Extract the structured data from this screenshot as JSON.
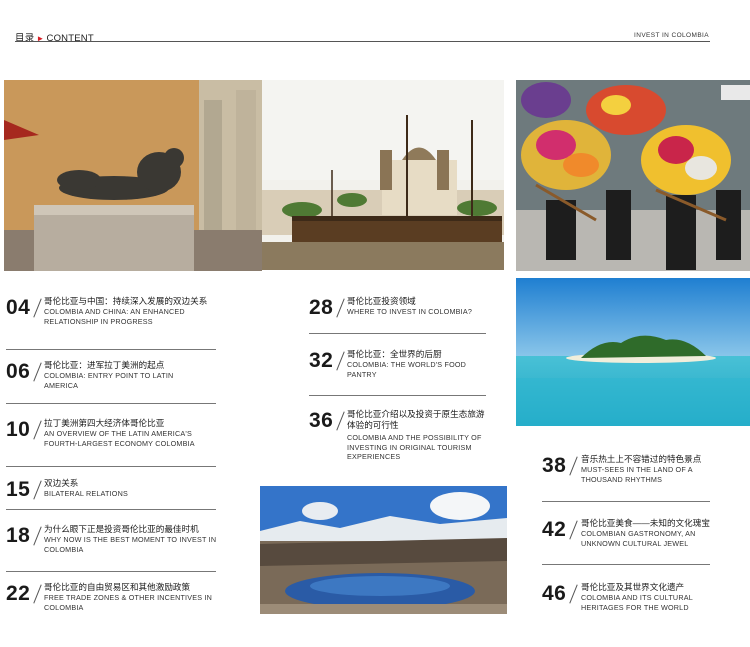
{
  "header": {
    "title_cn": "目录",
    "title_en": "CONTENT",
    "publication": "INVEST IN COLOMBIA"
  },
  "photos": {
    "sculpture": "botero-sculpture-photo",
    "cartagena": "cartagena-ship-photo",
    "flowers": "flower-festival-photo",
    "island": "tropical-island-photo",
    "lagoon": "andes-lagoon-photo"
  },
  "entries": [
    {
      "num": "04",
      "cn": "哥伦比亚与中国：持续深入发展的双边关系",
      "en": "COLOMBIA AND CHINA: AN ENHANCED RELATIONSHIP IN PROGRESS"
    },
    {
      "num": "06",
      "cn": "哥伦比亚：进军拉丁美洲的起点",
      "en": "COLOMBIA: ENTRY POINT TO LATIN AMERICA"
    },
    {
      "num": "10",
      "cn": "拉丁美洲第四大经济体哥伦比亚",
      "en": "AN OVERVIEW OF THE LATIN AMERICA'S FOURTH-LARGEST ECONOMY COLOMBIA"
    },
    {
      "num": "15",
      "cn": "双边关系",
      "en": "BILATERAL RELATIONS"
    },
    {
      "num": "18",
      "cn": "为什么眼下正是投资哥伦比亚的最佳时机",
      "en": "WHY NOW IS THE BEST MOMENT TO INVEST IN COLOMBIA"
    },
    {
      "num": "22",
      "cn": "哥伦比亚的自由贸易区和其他激励政策",
      "en": "FREE TRADE ZONES & OTHER INCENTIVES IN COLOMBIA"
    },
    {
      "num": "28",
      "cn": "哥伦比亚投资领域",
      "en": "WHERE TO INVEST IN COLOMBIA?"
    },
    {
      "num": "32",
      "cn": "哥伦比亚：全世界的后厨",
      "en": "COLOMBIA: THE WORLD'S FOOD PANTRY"
    },
    {
      "num": "36",
      "cn": "哥伦比亚介绍以及投资于原生态旅游体验的可行性",
      "en": "COLOMBIA AND THE POSSIBILITY OF INVESTING IN ORIGINAL TOURISM EXPERIENCES"
    },
    {
      "num": "38",
      "cn": "音乐热土上不容错过的特色景点",
      "en": "MUST-SEES IN THE LAND OF A THOUSAND RHYTHMS"
    },
    {
      "num": "42",
      "cn": "哥伦比亚美食——未知的文化瑰宝",
      "en": "COLOMBIAN GASTRONOMY, AN UNKNOWN CULTURAL JEWEL"
    },
    {
      "num": "46",
      "cn": "哥伦比亚及其世界文化遗产",
      "en": "COLOMBIA AND ITS CULTURAL HERITAGES FOR THE WORLD"
    }
  ]
}
